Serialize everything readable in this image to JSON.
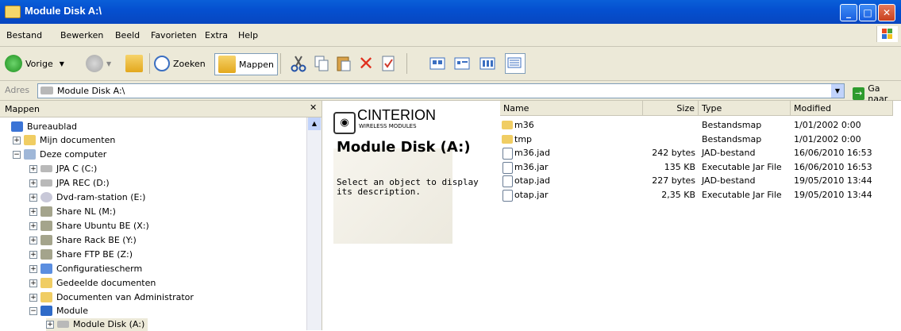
{
  "window": {
    "title": "Module Disk A:\\"
  },
  "menu": [
    "Bestand",
    "Bewerken",
    "Beeld",
    "Favorieten",
    "Extra",
    "Help"
  ],
  "toolbar": {
    "back": "Vorige",
    "search": "Zoeken",
    "folders": "Mappen"
  },
  "address": {
    "label": "Adres",
    "value": "Module Disk A:\\",
    "go": "Ga naar"
  },
  "tree": {
    "header": "Mappen",
    "items": [
      {
        "label": "Bureaublad",
        "icon": "desktop-icon"
      },
      {
        "label": "Mijn documenten",
        "icon": "folder-icon"
      },
      {
        "label": "Deze computer",
        "icon": "computer-icon"
      },
      {
        "label": "JPA C (C:)",
        "icon": "drive-icon"
      },
      {
        "label": "JPA REC (D:)",
        "icon": "drive-icon"
      },
      {
        "label": "Dvd-ram-station (E:)",
        "icon": "dvd-icon"
      },
      {
        "label": "Share NL (M:)",
        "icon": "network-drive-icon"
      },
      {
        "label": "Share Ubuntu BE (X:)",
        "icon": "network-drive-icon"
      },
      {
        "label": "Share Rack BE (Y:)",
        "icon": "network-drive-icon"
      },
      {
        "label": "Share FTP BE (Z:)",
        "icon": "network-drive-icon"
      },
      {
        "label": "Configuratiescherm",
        "icon": "control-panel-icon"
      },
      {
        "label": "Gedeelde documenten",
        "icon": "folder-icon"
      },
      {
        "label": "Documenten van Administrator",
        "icon": "folder-icon"
      },
      {
        "label": "Module",
        "icon": "module-icon"
      },
      {
        "label": "Module Disk (A:)",
        "icon": "drive-icon"
      }
    ]
  },
  "info": {
    "brand": "CINTERION",
    "brand_sub": "WIRELESS MODULES",
    "title": "Module Disk (A:)",
    "description": "Select an object to display its description."
  },
  "list": {
    "columns": [
      "Name",
      "Size",
      "Type",
      "Modified"
    ],
    "rows": [
      {
        "name": "m36",
        "size": "",
        "type": "Bestandsmap",
        "modified": "1/01/2002 0:00"
      },
      {
        "name": "tmp",
        "size": "",
        "type": "Bestandsmap",
        "modified": "1/01/2002 0:00"
      },
      {
        "name": "m36.jad",
        "size": "242 bytes",
        "type": "JAD-bestand",
        "modified": "16/06/2010 16:53"
      },
      {
        "name": "m36.jar",
        "size": "135 KB",
        "type": "Executable Jar File",
        "modified": "16/06/2010 16:53"
      },
      {
        "name": "otap.jad",
        "size": "227 bytes",
        "type": "JAD-bestand",
        "modified": "19/05/2010 13:44"
      },
      {
        "name": "otap.jar",
        "size": "2,35 KB",
        "type": "Executable Jar File",
        "modified": "19/05/2010 13:44"
      }
    ]
  }
}
